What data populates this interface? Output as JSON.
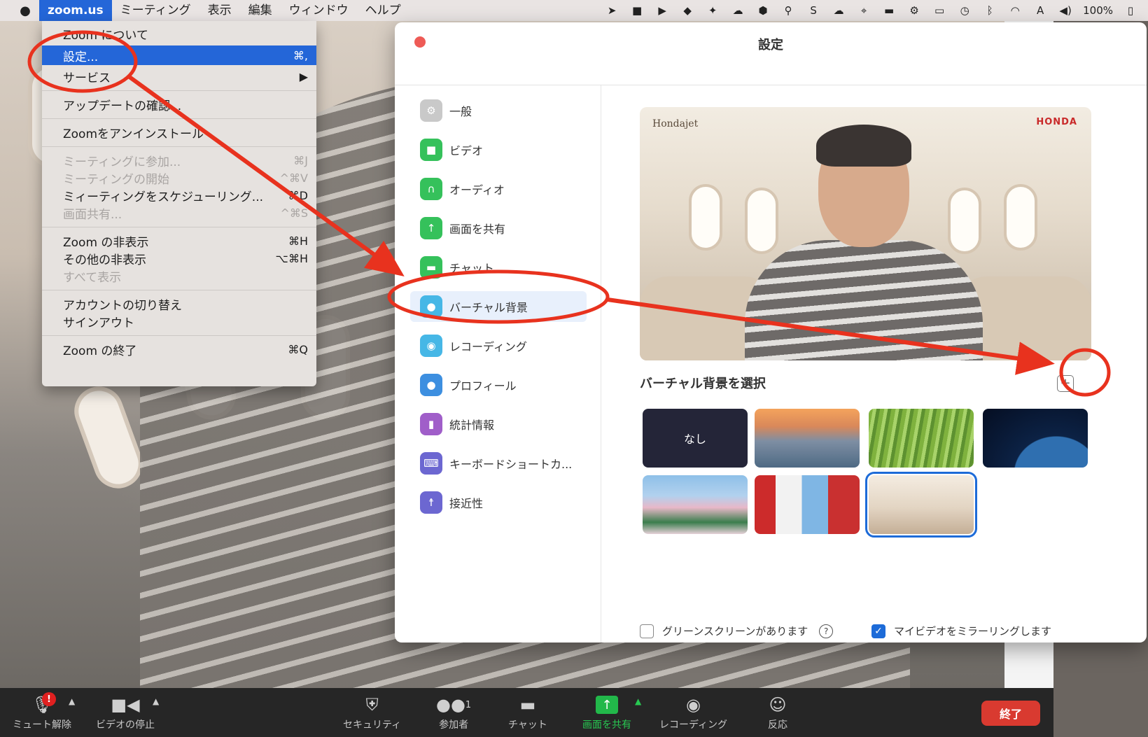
{
  "menubar": {
    "app_name": "zoom.us",
    "menus": [
      "ミーティング",
      "表示",
      "編集",
      "ウィンドウ",
      "ヘルプ"
    ],
    "battery": "100%"
  },
  "dropdown": {
    "about": "Zoom について",
    "preferences": "設定...",
    "preferences_shortcut": "⌘,",
    "services": "サービス",
    "check_updates": "アップデートの確認...",
    "uninstall": "Zoomをアンインストール",
    "join_meeting": "ミーティングに参加...",
    "join_meeting_shortcut": "⌘J",
    "start_meeting": "ミーティングの開始",
    "start_meeting_shortcut": "^⌘V",
    "schedule_meeting": "ミィーティングをスケジューリング...",
    "schedule_meeting_shortcut": "⌘D",
    "share_screen": "画面共有...",
    "share_screen_shortcut": "^⌘S",
    "hide_zoom": "Zoom の非表示",
    "hide_zoom_shortcut": "⌘H",
    "hide_others": "その他の非表示",
    "hide_others_shortcut": "⌥⌘H",
    "show_all": "すべて表示",
    "switch_account": "アカウントの切り替え",
    "sign_out": "サインアウト",
    "quit": "Zoom の終了",
    "quit_shortcut": "⌘Q"
  },
  "settings": {
    "title": "設定",
    "sidebar": [
      {
        "label": "一般",
        "icon": "gear-icon",
        "color": "#c9c9c9"
      },
      {
        "label": "ビデオ",
        "icon": "camera-icon",
        "color": "#35c15b"
      },
      {
        "label": "オーディオ",
        "icon": "headphones-icon",
        "color": "#35c15b"
      },
      {
        "label": "画面を共有",
        "icon": "share-screen-icon",
        "color": "#35c15b"
      },
      {
        "label": "チャット",
        "icon": "chat-icon",
        "color": "#35c15b"
      },
      {
        "label": "バーチャル背景",
        "icon": "person-icon",
        "color": "#46b7e6"
      },
      {
        "label": "レコーディング",
        "icon": "record-icon",
        "color": "#46b7e6"
      },
      {
        "label": "プロフィール",
        "icon": "profile-icon",
        "color": "#3d8fe0"
      },
      {
        "label": "統計情報",
        "icon": "stats-icon",
        "color": "#a05ec9"
      },
      {
        "label": "キーボードショートカ...",
        "icon": "keyboard-icon",
        "color": "#6c67d1"
      },
      {
        "label": "接近性",
        "icon": "accessibility-icon",
        "color": "#6c67d1"
      }
    ],
    "preview_logo_left": "Hondajet",
    "preview_logo_right": "HONDA",
    "choose_label": "バーチャル背景を選択",
    "none_label": "なし",
    "green_screen": "グリーンスクリーンがあります",
    "mirror_video": "マイビデオをミラーリングします"
  },
  "toolbar": {
    "unmute": "ミュート解除",
    "stop_video": "ビデオの停止",
    "security": "セキュリティ",
    "participants": "参加者",
    "participants_count": "1",
    "chat": "チャット",
    "share_screen": "画面を共有",
    "recording": "レコーディング",
    "reactions": "反応",
    "end": "終了",
    "badge": "!"
  },
  "colors": {
    "accent": "#1d6bd8",
    "annotation_red": "#e8321e",
    "end_red": "#d93a30",
    "share_green": "#22b84a"
  }
}
